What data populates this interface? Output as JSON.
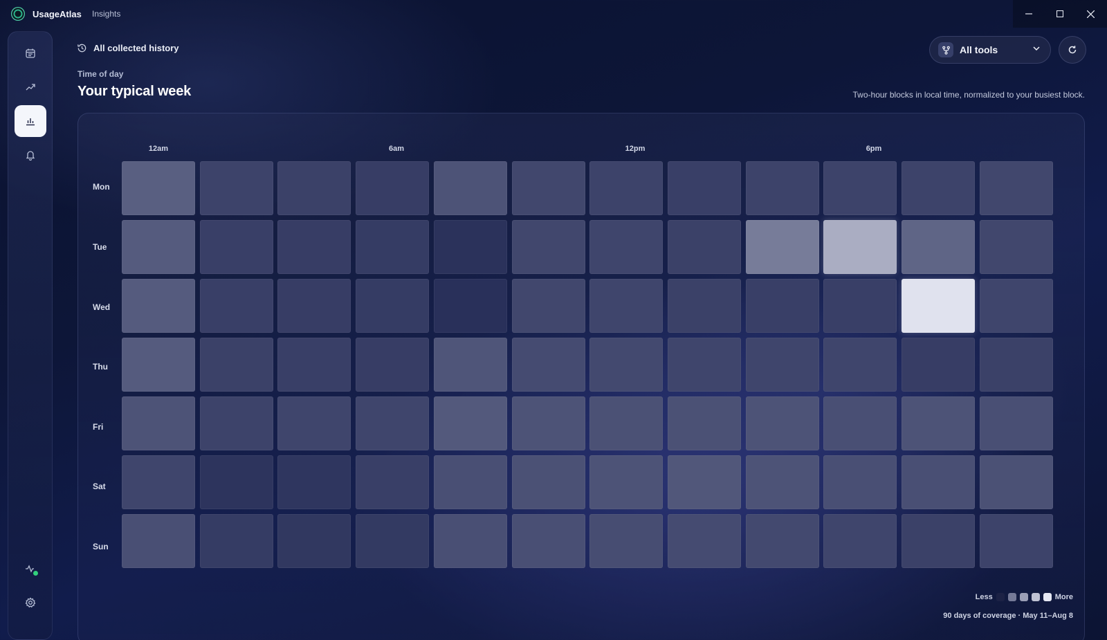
{
  "app": {
    "name": "UsageAtlas",
    "section": "Insights"
  },
  "window_controls": {
    "minimize": "—",
    "maximize": "☐",
    "close": "✕"
  },
  "sidebar": {
    "items": [
      {
        "icon": "calendar-icon",
        "active": false
      },
      {
        "icon": "trend-icon",
        "active": false
      },
      {
        "icon": "bar-chart-icon",
        "active": true
      },
      {
        "icon": "bell-icon",
        "active": false
      }
    ],
    "bottom": [
      {
        "icon": "activity-status-icon",
        "status_color": "#32d07d"
      },
      {
        "icon": "gear-icon"
      }
    ]
  },
  "header": {
    "history_label": "All collected history",
    "eyebrow": "Time of day",
    "title": "Your typical week",
    "subtitle": "Two-hour blocks in local time, normalized to your busiest block.",
    "tool_filter": "All tools"
  },
  "heatmap": {
    "hour_labels": [
      "12am",
      "6am",
      "12pm",
      "6pm"
    ],
    "days": [
      "Mon",
      "Tue",
      "Wed",
      "Thu",
      "Fri",
      "Sat",
      "Sun"
    ],
    "intensity": [
      [
        0.3,
        0.16,
        0.15,
        0.13,
        0.24,
        0.18,
        0.16,
        0.14,
        0.16,
        0.16,
        0.16,
        0.18
      ],
      [
        0.28,
        0.14,
        0.13,
        0.12,
        0.07,
        0.18,
        0.17,
        0.15,
        0.45,
        0.7,
        0.33,
        0.18
      ],
      [
        0.28,
        0.14,
        0.13,
        0.12,
        0.06,
        0.18,
        0.17,
        0.15,
        0.14,
        0.14,
        0.97,
        0.17
      ],
      [
        0.28,
        0.15,
        0.14,
        0.13,
        0.25,
        0.2,
        0.19,
        0.17,
        0.17,
        0.17,
        0.13,
        0.15
      ],
      [
        0.24,
        0.16,
        0.17,
        0.17,
        0.27,
        0.24,
        0.23,
        0.23,
        0.24,
        0.22,
        0.24,
        0.22
      ],
      [
        0.17,
        0.08,
        0.09,
        0.14,
        0.22,
        0.23,
        0.24,
        0.26,
        0.24,
        0.22,
        0.22,
        0.23
      ],
      [
        0.22,
        0.12,
        0.1,
        0.11,
        0.22,
        0.22,
        0.21,
        0.2,
        0.19,
        0.17,
        0.15,
        0.16
      ]
    ],
    "legend": {
      "less": "Less",
      "more": "More",
      "steps": [
        0.0,
        0.25,
        0.5,
        0.75,
        1.0
      ]
    },
    "coverage": "90 days of coverage · May 11–Aug 8"
  },
  "colors": {
    "cell_low": "#1d2450",
    "cell_high": "#e6e8f3",
    "status_ok": "#32d07d"
  }
}
